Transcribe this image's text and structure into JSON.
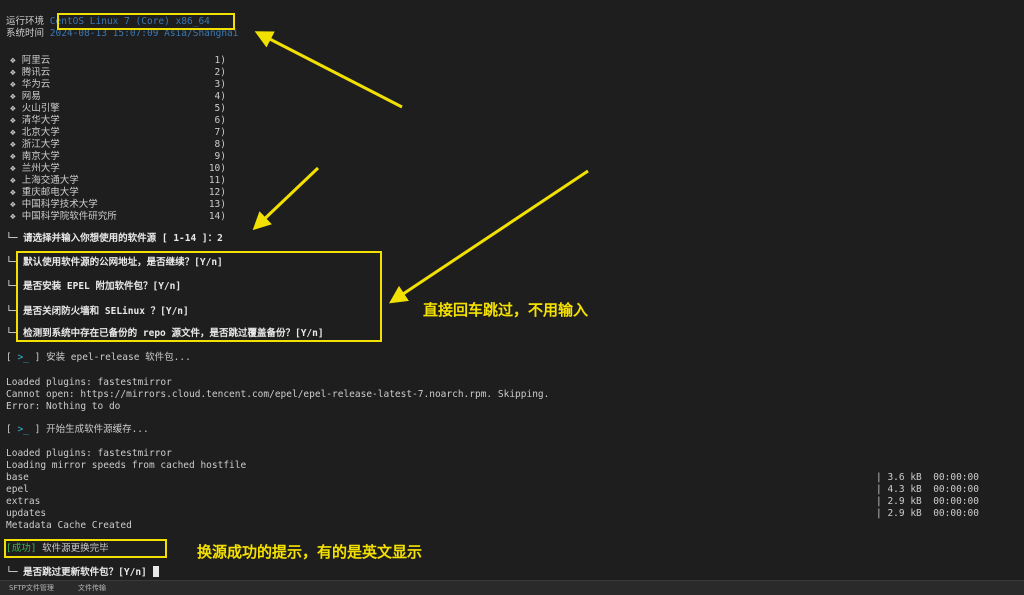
{
  "env": {
    "run_env_label": "运行环境",
    "run_env_value": "CentOS Linux 7 (Core) x86_64",
    "sys_time_label": "系统时间",
    "sys_time_value": "2024-08-13 15:07:09 Asia/Shanghai"
  },
  "mirrors": [
    {
      "name": "阿里云",
      "num": "1)"
    },
    {
      "name": "腾讯云",
      "num": "2)"
    },
    {
      "name": "华为云",
      "num": "3)"
    },
    {
      "name": "网易",
      "num": "4)"
    },
    {
      "name": "火山引擎",
      "num": "5)"
    },
    {
      "name": "清华大学",
      "num": "6)"
    },
    {
      "name": "北京大学",
      "num": "7)"
    },
    {
      "name": "浙江大学",
      "num": "8)"
    },
    {
      "name": "南京大学",
      "num": "9)"
    },
    {
      "name": "兰州大学",
      "num": "10)"
    },
    {
      "name": "上海交通大学",
      "num": "11)"
    },
    {
      "name": "重庆邮电大学",
      "num": "12)"
    },
    {
      "name": "中国科学技术大学",
      "num": "13)"
    },
    {
      "name": "中国科学院软件研究所",
      "num": "14)"
    }
  ],
  "bullet": "❖",
  "prompts": {
    "select": "└─ 请选择并输入你想使用的软件源 [ 1-14 ]：2",
    "q1": "└─ 默认使用软件源的公网地址，是否继续？[Y/n]",
    "q2": "└─ 是否安装 EPEL 附加软件包？[Y/n]",
    "q3": "└─ 是否关闭防火墙和 SELinux ？[Y/n]",
    "q4": "└─ 检测到系统中存在已备份的 repo 源文件，是否跳过覆盖备份？[Y/n]",
    "last": "└─ 是否跳过更新软件包？[Y/n]"
  },
  "steps": {
    "prompt_symbol": ">_",
    "install_epel": "安装 epel-release 软件包...",
    "gen_cache": "开始生成软件源缓存..."
  },
  "log1": [
    "Loaded plugins: fastestmirror",
    "Cannot open: https://mirrors.cloud.tencent.com/epel/epel-release-latest-7.noarch.rpm. Skipping.",
    "Error: Nothing to do"
  ],
  "log2": [
    "Loaded plugins: fastestmirror",
    "Loading mirror speeds from cached hostfile"
  ],
  "repos": [
    {
      "name": "base",
      "size": "| 3.6 kB  00:00:00"
    },
    {
      "name": "epel",
      "size": "| 4.3 kB  00:00:00"
    },
    {
      "name": "extras",
      "size": "| 2.9 kB  00:00:00"
    },
    {
      "name": "updates",
      "size": "| 2.9 kB  00:00:00"
    }
  ],
  "metadata": "Metadata Cache Created",
  "success": {
    "tag": "[成功]",
    "text": " 软件源更换完毕"
  },
  "annotations": {
    "skip_enter": "直接回车跳过，不用输入",
    "success_hint": "换源成功的提示，有的是英文显示"
  },
  "status_bar": {
    "sftp": "SFTP文件管理",
    "transfer": "文件传输"
  },
  "colors": {
    "highlight": "#f2e100",
    "background": "#1e1e1e"
  }
}
